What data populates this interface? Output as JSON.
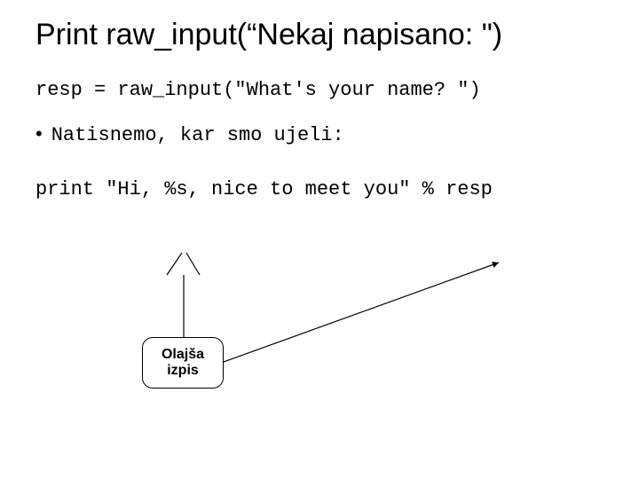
{
  "title": "Print raw_input(“Nekaj napisano: \")",
  "code_line_1": "resp = raw_input(\"What's your name? \")",
  "bullet_text": "Natisnemo, kar smo ujeli:",
  "code_line_2": "print \"Hi, %s, nice to meet you\" % resp",
  "callout_line1": "Olajša",
  "callout_line2": "izpis"
}
